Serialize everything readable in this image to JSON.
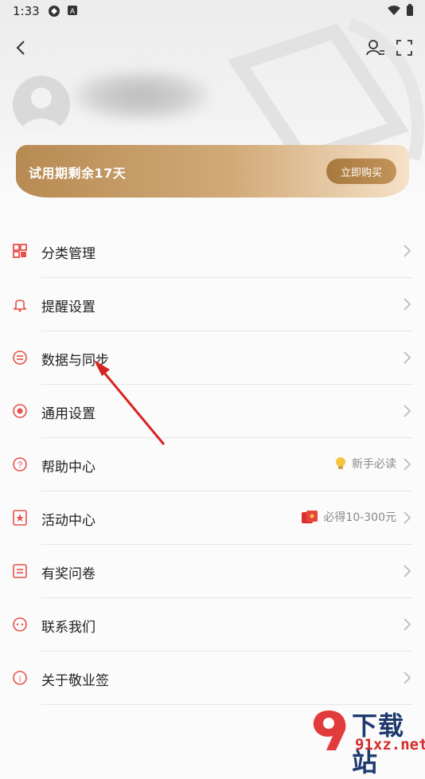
{
  "status_bar": {
    "time": "1:33"
  },
  "profile": {
    "trial_text": "试用期剩余17天",
    "buy_label": "立即购买"
  },
  "menu": [
    {
      "label": "分类管理",
      "icon": "category-icon"
    },
    {
      "label": "提醒设置",
      "icon": "bell-icon"
    },
    {
      "label": "数据与同步",
      "icon": "sync-icon"
    },
    {
      "label": "通用设置",
      "icon": "settings-circle-icon"
    },
    {
      "label": "帮助中心",
      "icon": "help-icon",
      "extra": "新手必读",
      "extra_icon": "lightbulb-icon"
    },
    {
      "label": "活动中心",
      "icon": "activity-icon",
      "extra": "必得10-300元",
      "extra_icon": "red-envelope-icon"
    },
    {
      "label": "有奖问卷",
      "icon": "survey-icon"
    },
    {
      "label": "联系我们",
      "icon": "chat-icon"
    },
    {
      "label": "关于敬业签",
      "icon": "info-icon"
    }
  ],
  "watermark": {
    "title": "下载站",
    "url": "91xz.net"
  },
  "colors": {
    "accent_red": "#e8504a",
    "gold": "#c29359"
  }
}
